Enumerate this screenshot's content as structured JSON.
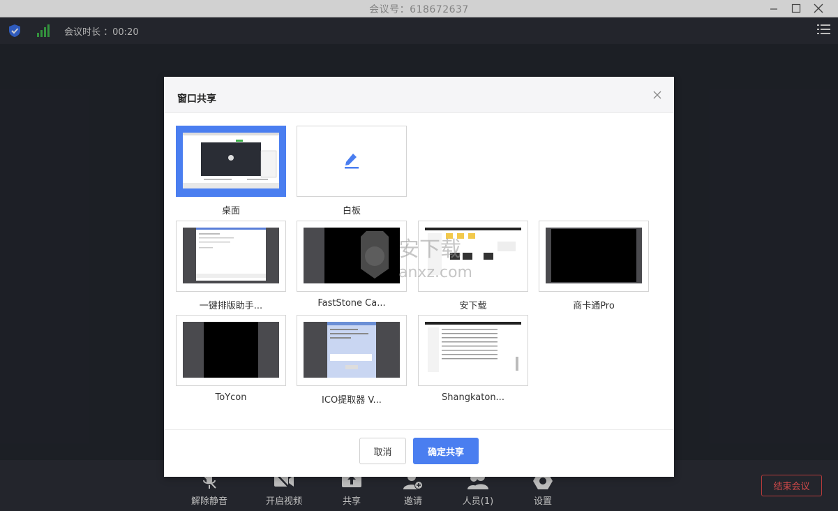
{
  "window": {
    "title": "会议号：618672637"
  },
  "topbar": {
    "duration_label": "会议时长 ：00:20"
  },
  "toolbar": {
    "items": [
      {
        "label": "解除静音",
        "icon": "mic-off-icon"
      },
      {
        "label": "开启视频",
        "icon": "video-off-icon"
      },
      {
        "label": "共享",
        "icon": "share-upload-icon"
      },
      {
        "label": "邀请",
        "icon": "invite-user-icon"
      },
      {
        "label": "人员(1)",
        "icon": "participants-icon"
      },
      {
        "label": "设置",
        "icon": "settings-gear-icon"
      }
    ],
    "end_label": "结束会议"
  },
  "dialog": {
    "title": "窗口共享",
    "items": [
      {
        "label": "桌面",
        "selected": true
      },
      {
        "label": "白板",
        "selected": false
      },
      {
        "label": "一键排版助手...",
        "selected": false
      },
      {
        "label": "FastStone Ca...",
        "selected": false
      },
      {
        "label": "安下载",
        "selected": false
      },
      {
        "label": "商卡通Pro",
        "selected": false
      },
      {
        "label": "ToYcon",
        "selected": false
      },
      {
        "label": "ICO提取器 V...",
        "selected": false
      },
      {
        "label": "Shangkaton...",
        "selected": false
      }
    ],
    "cancel_label": "取消",
    "ok_label": "确定共享"
  },
  "watermark": {
    "text": "anxz.com",
    "logo_text": "安下载"
  },
  "colors": {
    "accent": "#4a7ef0",
    "end_red": "#e04848",
    "bg_dark": "#23262e",
    "bar_dark": "#2b2e36"
  }
}
